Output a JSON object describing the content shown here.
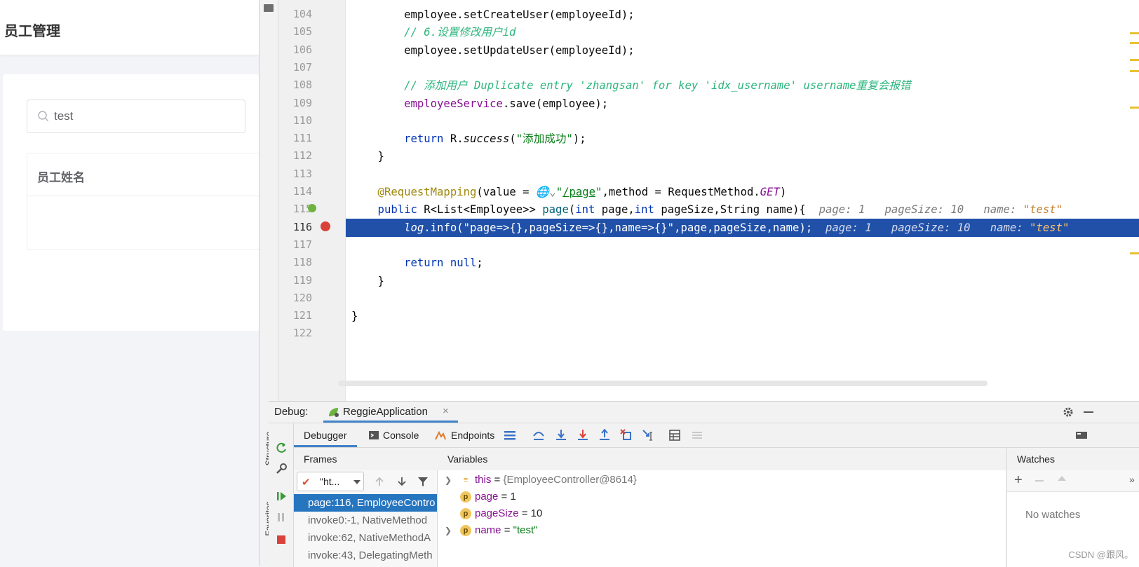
{
  "webapp": {
    "title": "员工管理",
    "search": {
      "value": "test"
    },
    "table": {
      "header": "员工姓名"
    }
  },
  "editor": {
    "lines": [
      {
        "no": "104",
        "parts": [
          [
            "",
            "        employee.setCreateUser(employeeId);"
          ]
        ]
      },
      {
        "no": "105",
        "parts": [
          [
            "cmt",
            "        // 6.设置修改用户id"
          ]
        ]
      },
      {
        "no": "106",
        "parts": [
          [
            "",
            "        employee.setUpdateUser(employeeId);"
          ]
        ]
      },
      {
        "no": "107",
        "parts": []
      },
      {
        "no": "108",
        "parts": [
          [
            "cmt",
            "        // 添加用户 Duplicate entry 'zhangsan' for key 'idx_username' username重复会报错"
          ]
        ]
      },
      {
        "no": "109",
        "parts": [
          [
            "fld",
            "        employeeService"
          ],
          [
            "",
            ".save(employee);"
          ]
        ]
      },
      {
        "no": "110",
        "parts": []
      },
      {
        "no": "111",
        "parts": [
          [
            "kw",
            "        return "
          ],
          [
            "",
            "R."
          ],
          [
            "italic",
            "success"
          ],
          [
            "",
            "("
          ],
          [
            "str",
            "\"添加成功\""
          ],
          [
            "",
            ");"
          ]
        ]
      },
      {
        "no": "112",
        "parts": [
          [
            "",
            "    }"
          ]
        ]
      },
      {
        "no": "113",
        "parts": []
      },
      {
        "no": "114",
        "parts": [
          [
            "ann",
            "    @RequestMapping"
          ],
          [
            "",
            "(value = "
          ],
          [
            "hint",
            "🌐⌄"
          ],
          [
            "str",
            "\""
          ],
          [
            "url",
            "/page"
          ],
          [
            "str",
            "\""
          ],
          [
            "",
            ",method = RequestMethod."
          ],
          [
            "stat",
            "GET"
          ],
          [
            "",
            ")"
          ]
        ]
      },
      {
        "no": "115",
        "parts": [
          [
            "kw",
            "    public "
          ],
          [
            "",
            "R<List<Employee>> "
          ],
          [
            "meth",
            "page"
          ],
          [
            "",
            "("
          ],
          [
            "kw",
            "int "
          ],
          [
            "",
            "page,"
          ],
          [
            "kw",
            "int "
          ],
          [
            "",
            "pageSize,String name){  "
          ],
          [
            "hint",
            "page: 1   pageSize: 10   name: "
          ],
          [
            "hintstr",
            "\"test\""
          ]
        ]
      },
      {
        "no": "116",
        "sel": true,
        "parts": [
          [
            "stat",
            "        log"
          ],
          [
            "",
            ".info("
          ],
          [
            "str",
            "\"page=>{},pageSize=>{},name=>{}\""
          ],
          [
            "",
            ",page,pageSize,name);  "
          ],
          [
            "hint",
            "page: 1   pageSize: 10   name: "
          ],
          [
            "hintstr",
            "\"test\""
          ]
        ]
      },
      {
        "no": "117",
        "parts": []
      },
      {
        "no": "118",
        "parts": [
          [
            "kw",
            "        return null"
          ],
          [
            "",
            ";"
          ]
        ]
      },
      {
        "no": "119",
        "parts": [
          [
            "",
            "    }"
          ]
        ]
      },
      {
        "no": "120",
        "parts": []
      },
      {
        "no": "121",
        "parts": [
          [
            "",
            "}"
          ]
        ]
      },
      {
        "no": "122",
        "parts": []
      }
    ]
  },
  "sidebar": {
    "structure_label": "Structure",
    "favorites_label": "Favorites"
  },
  "debug": {
    "label": "Debug:",
    "run_config": "ReggieApplication",
    "tabs": [
      "Debugger",
      "Console",
      "Endpoints"
    ],
    "frames_header": "Frames",
    "variables_header": "Variables",
    "watches_header": "Watches",
    "thread": "\"ht...",
    "frames": [
      "page:116, EmployeeContro",
      "invoke0:-1, NativeMethod",
      "invoke:62, NativeMethodA",
      "invoke:43, DelegatingMeth"
    ],
    "variables": [
      {
        "name": "this",
        "value": "{EmployeeController@8614}",
        "kind": "obj",
        "expand": true
      },
      {
        "name": "page",
        "value": "1",
        "kind": "num",
        "expand": false
      },
      {
        "name": "pageSize",
        "value": "10",
        "kind": "num",
        "expand": false
      },
      {
        "name": "name",
        "value": "\"test\"",
        "kind": "str",
        "expand": true
      }
    ],
    "no_watches": "No watches"
  },
  "watermark": "CSDN @跟风。",
  "colors": {
    "selection": "#2150a8",
    "frame_selected": "#2675bf",
    "comment": "#2cb67d",
    "keyword": "#0033b3"
  }
}
